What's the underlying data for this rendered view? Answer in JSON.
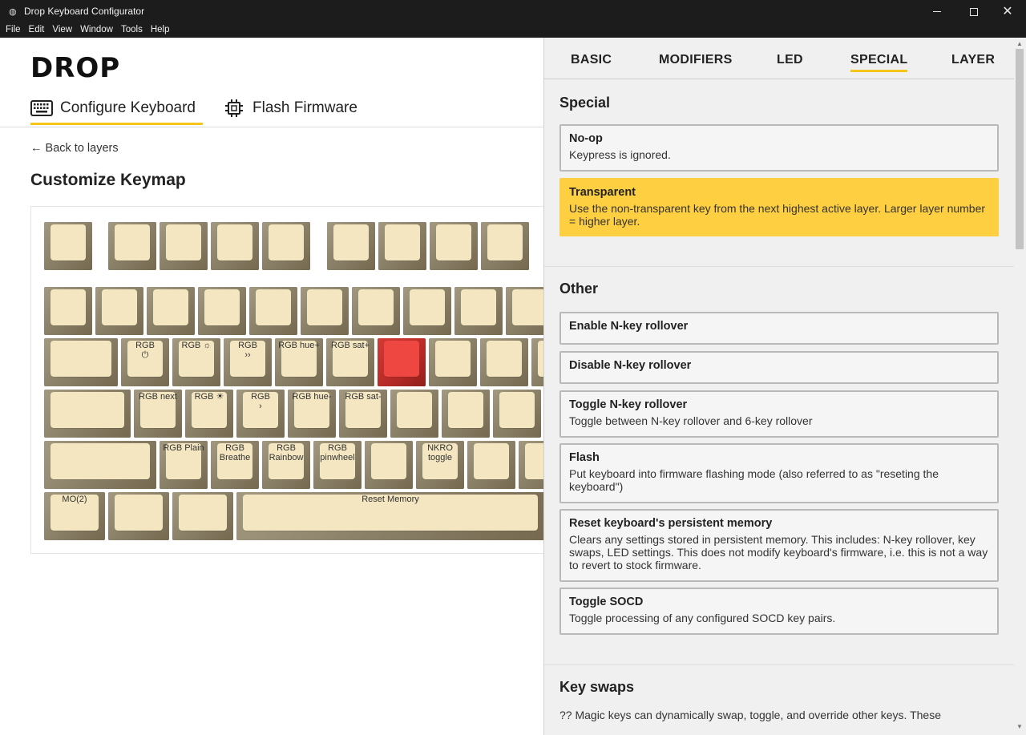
{
  "window": {
    "title": "Drop Keyboard Configurator"
  },
  "menu": [
    "File",
    "Edit",
    "View",
    "Window",
    "Tools",
    "Help"
  ],
  "brand": {
    "logo_text": "DROP"
  },
  "nav": {
    "tabs": [
      {
        "label": "Configure Keyboard",
        "icon": "keyboard-icon",
        "active": true
      },
      {
        "label": "Flash Firmware",
        "icon": "chip-icon",
        "active": false
      }
    ]
  },
  "main": {
    "back_label": "← Back to layers",
    "title": "Customize Keymap"
  },
  "keyboard": {
    "rows": [
      [
        {
          "label": ""
        },
        {
          "label": ""
        },
        {
          "label": ""
        },
        {
          "label": ""
        },
        {
          "label": ""
        },
        {
          "label": ""
        },
        {
          "label": ""
        },
        {
          "label": ""
        },
        {
          "label": ""
        }
      ],
      [
        {
          "label": ""
        },
        {
          "label": ""
        },
        {
          "label": ""
        },
        {
          "label": ""
        },
        {
          "label": ""
        },
        {
          "label": ""
        },
        {
          "label": ""
        },
        {
          "label": ""
        },
        {
          "label": ""
        },
        {
          "label": ""
        }
      ],
      [
        {
          "label": ""
        },
        {
          "label": "RGB\n⏻"
        },
        {
          "label": "RGB ☼"
        },
        {
          "label": "RGB\n››"
        },
        {
          "label": "RGB hue+"
        },
        {
          "label": "RGB sat+"
        },
        {
          "label": "",
          "selected": true
        },
        {
          "label": ""
        },
        {
          "label": ""
        },
        {
          "label": ""
        }
      ],
      [
        {
          "label": ""
        },
        {
          "label": "RGB next"
        },
        {
          "label": "RGB ☀"
        },
        {
          "label": "RGB\n›"
        },
        {
          "label": "RGB hue-"
        },
        {
          "label": "RGB sat-"
        },
        {
          "label": ""
        },
        {
          "label": ""
        },
        {
          "label": ""
        }
      ],
      [
        {
          "label": ""
        },
        {
          "label": "RGB Plain"
        },
        {
          "label": "RGB\nBreathe"
        },
        {
          "label": "RGB\nRainbow"
        },
        {
          "label": "RGB\npinwheel"
        },
        {
          "label": ""
        },
        {
          "label": "NKRO\ntoggle"
        },
        {
          "label": ""
        },
        {
          "label": ""
        }
      ],
      [
        {
          "label": "MO(2)"
        },
        {
          "label": ""
        },
        {
          "label": ""
        },
        {
          "label": "Reset Memory"
        }
      ]
    ]
  },
  "panel": {
    "tabs": [
      {
        "label": "BASIC",
        "active": false
      },
      {
        "label": "MODIFIERS",
        "active": false
      },
      {
        "label": "LED",
        "active": false
      },
      {
        "label": "SPECIAL",
        "active": true
      },
      {
        "label": "LAYER",
        "active": false
      }
    ],
    "sections": [
      {
        "title": "Special",
        "items": [
          {
            "title": "No-op",
            "desc": "Keypress is ignored.",
            "highlight": false
          },
          {
            "title": "Transparent",
            "desc": "Use the non-transparent key from the next highest active layer. Larger layer number = higher layer.",
            "highlight": true
          }
        ]
      },
      {
        "title": "Other",
        "items": [
          {
            "title": "Enable N-key rollover",
            "desc": ""
          },
          {
            "title": "Disable N-key rollover",
            "desc": ""
          },
          {
            "title": "Toggle N-key rollover",
            "desc": "Toggle between N-key rollover and 6-key rollover"
          },
          {
            "title": "Flash",
            "desc": "Put keyboard into firmware flashing mode (also referred to as \"reseting the keyboard\")"
          },
          {
            "title": "Reset keyboard's persistent memory",
            "desc": "Clears any settings stored in persistent memory. This includes: N-key rollover, key swaps, LED settings. This does not modify keyboard's firmware, i.e. this is not a way to revert to stock firmware."
          },
          {
            "title": "Toggle SOCD",
            "desc": "Toggle processing of any configured SOCD key pairs."
          }
        ]
      },
      {
        "title": "Key swaps",
        "intro": "?? Magic keys can dynamically swap, toggle, and override other keys. These"
      }
    ]
  },
  "colors": {
    "accent": "#f5c518",
    "highlight_card": "#fecf40",
    "keycap": "#f3e6c0",
    "key_base": "#8a8068",
    "selected_key": "#ee4640"
  }
}
